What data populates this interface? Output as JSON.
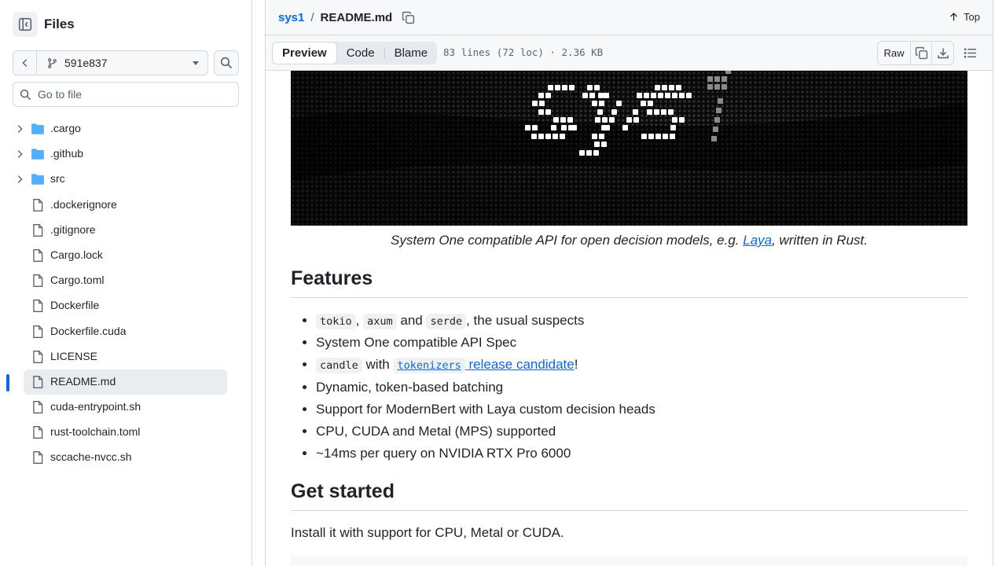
{
  "sidebar": {
    "title": "Files",
    "branch": "591e837",
    "search_placeholder": "Go to file",
    "items": [
      {
        "name": ".cargo",
        "type": "folder"
      },
      {
        "name": ".github",
        "type": "folder"
      },
      {
        "name": "src",
        "type": "folder"
      },
      {
        "name": ".dockerignore",
        "type": "file"
      },
      {
        "name": ".gitignore",
        "type": "file"
      },
      {
        "name": "Cargo.lock",
        "type": "file"
      },
      {
        "name": "Cargo.toml",
        "type": "file"
      },
      {
        "name": "Dockerfile",
        "type": "file"
      },
      {
        "name": "Dockerfile.cuda",
        "type": "file"
      },
      {
        "name": "LICENSE",
        "type": "file"
      },
      {
        "name": "README.md",
        "type": "file",
        "selected": true
      },
      {
        "name": "cuda-entrypoint.sh",
        "type": "file"
      },
      {
        "name": "rust-toolchain.toml",
        "type": "file"
      },
      {
        "name": "sccache-nvcc.sh",
        "type": "file"
      }
    ]
  },
  "header": {
    "repo": "sys1",
    "separator": "/",
    "file": "README.md",
    "top_label": "Top"
  },
  "filebar": {
    "tabs": [
      "Preview",
      "Code",
      "Blame"
    ],
    "active_tab": "Preview",
    "info": "83 lines (72 loc) · 2.36 KB",
    "raw_label": "Raw"
  },
  "readme": {
    "caption_pre": "System One compatible API for open decision models, e.g. ",
    "caption_link": "Laya",
    "caption_post": ", written in Rust.",
    "features_heading": "Features",
    "features": {
      "f1_code1": "tokio",
      "f1_sep1": ",",
      "f1_code2": "axum",
      "f1_and": "and",
      "f1_code3": "serde",
      "f1_tail": ", the usual suspects",
      "f2": "System One compatible API Spec",
      "f3_code": "candle",
      "f3_with": "with",
      "f3_link_code": "tokenizers",
      "f3_link_text": " release candidate",
      "f3_tail": "!",
      "f4": "Dynamic, token-based batching",
      "f5": "Support for ModernBert with Laya custom decision heads",
      "f6": "CPU, CUDA and Metal (MPS) supported",
      "f7": "~14ms per query on NVIDIA RTX Pro 6000"
    },
    "get_started_heading": "Get started",
    "install_text": "Install it with support for CPU, Metal or CUDA."
  },
  "colors": {
    "accent": "#0969da",
    "folder": "#54aeff",
    "border": "#d1d9e0"
  },
  "icons": {
    "sidebar_toggle": "sidebar-collapse-icon",
    "branch": "git-branch-icon",
    "search": "search-icon",
    "copy": "copy-icon",
    "download": "download-icon",
    "toc": "list-unordered-icon",
    "folder": "folder-icon",
    "file": "file-icon"
  }
}
